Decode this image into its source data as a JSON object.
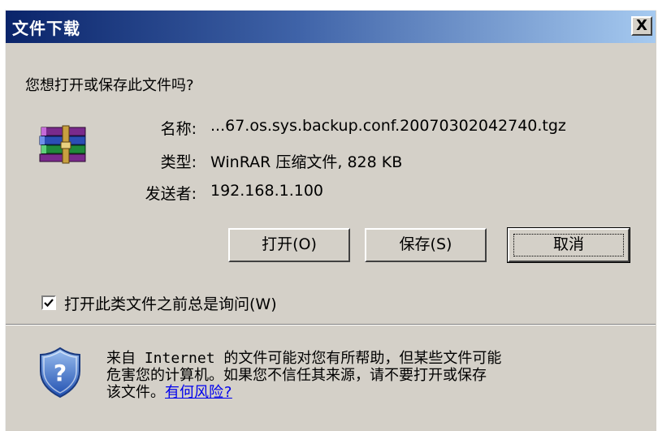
{
  "window": {
    "title": "文件下载",
    "close_label": "X"
  },
  "dialog": {
    "question": "您想打开或保存此文件吗?",
    "file_icon": "winrar-archive-icon",
    "fields": [
      {
        "label": "名称:",
        "value": "...67.os.sys.backup.conf.20070302042740.tgz"
      },
      {
        "label": "类型:",
        "value": "WinRAR 压缩文件, 828 KB"
      },
      {
        "label": "发送者:",
        "value": "192.168.1.100"
      }
    ],
    "buttons": {
      "open": "打开(O)",
      "save": "保存(S)",
      "cancel": "取消"
    },
    "checkbox": {
      "label": "打开此类文件之前总是询问(W)",
      "checked": true
    },
    "warning": {
      "icon": "security-shield-question-icon",
      "line1": "来自 Internet 的文件可能对您有所帮助，但某些文件可能",
      "line2": "危害您的计算机。如果您不信任其来源，请不要打开或保存",
      "line3_prefix": "该文件。",
      "link": "有何风险?"
    }
  },
  "colors": {
    "title_start": "#0a246a",
    "title_end": "#a6caf0",
    "face": "#d4d0c8",
    "link": "#0000ee"
  }
}
